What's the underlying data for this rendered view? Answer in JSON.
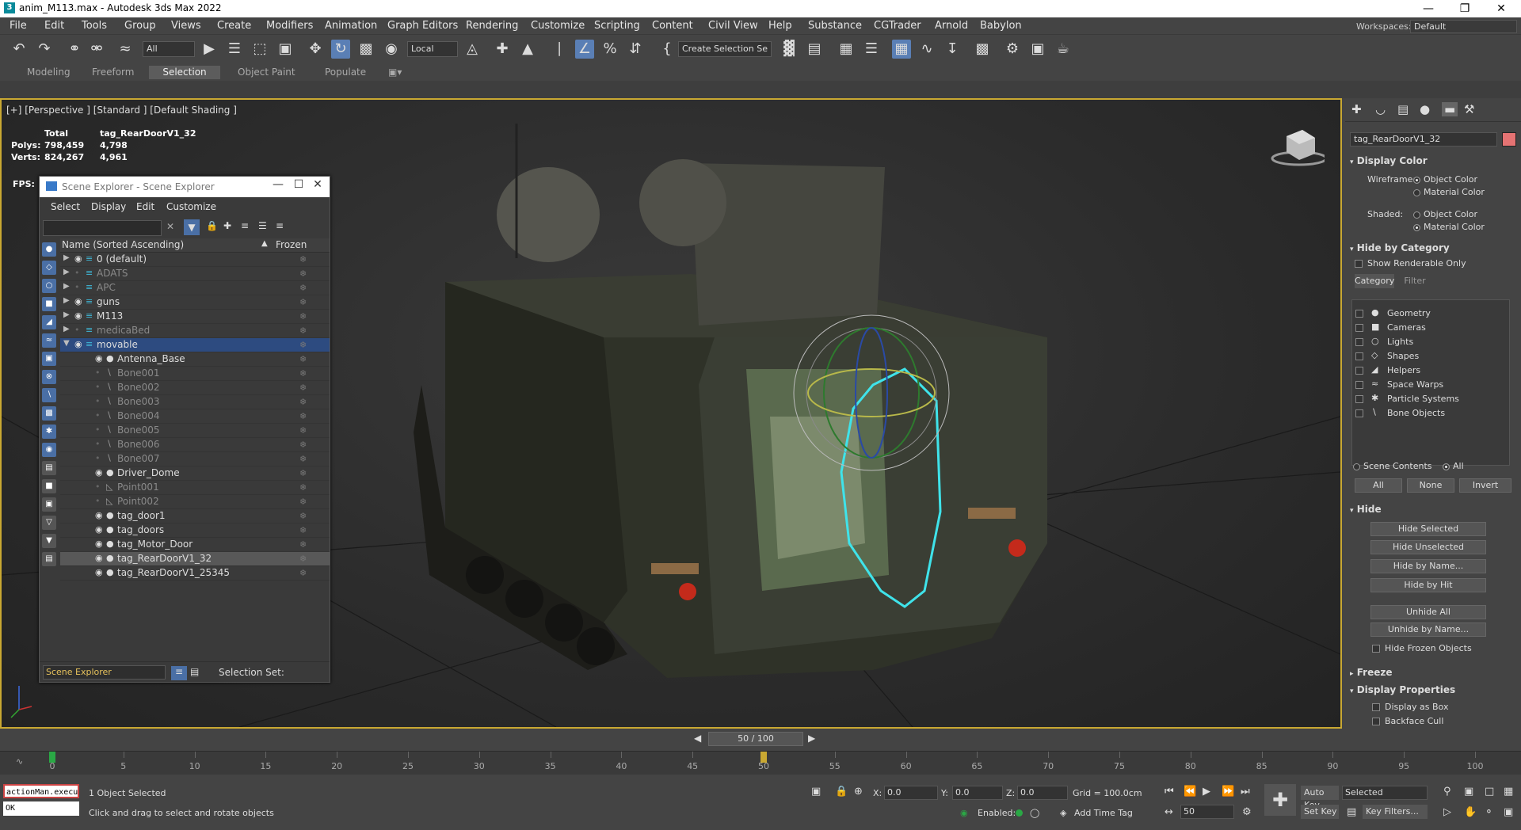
{
  "window": {
    "title": "anim_M113.max - Autodesk 3ds Max 2022",
    "app_icon": "3"
  },
  "menu": [
    "File",
    "Edit",
    "Tools",
    "Group",
    "Views",
    "Create",
    "Modifiers",
    "Animation",
    "Graph Editors",
    "Rendering",
    "Customize",
    "Scripting",
    "Content",
    "Civil View",
    "Help",
    "Substance",
    "CGTrader",
    "Arnold",
    "Babylon"
  ],
  "workspace": {
    "label": "Workspaces:",
    "value": "Default"
  },
  "toolbar": {
    "filter": "All",
    "coord": "Local",
    "selection_set": "Create Selection Se"
  },
  "ribbon_tabs": [
    "Modeling",
    "Freeform",
    "Selection",
    "Object Paint",
    "Populate"
  ],
  "viewport": {
    "label": "[+] [Perspective ] [Standard ] [Default Shading ]",
    "stats": {
      "total": "Total",
      "obj": "tag_RearDoorV1_32",
      "polys_label": "Polys:",
      "polys_total": "798,459",
      "polys_obj": "4,798",
      "verts_label": "Verts:",
      "verts_total": "824,267",
      "verts_obj": "4,961",
      "fps_label": "FPS:"
    }
  },
  "scene_explorer": {
    "title": "Scene Explorer - Scene Explorer",
    "menu": [
      "Select",
      "Display",
      "Edit",
      "Customize"
    ],
    "col_name": "Name (Sorted Ascending)",
    "col_frozen": "Frozen",
    "rows": [
      {
        "name": "0 (default)",
        "level": 0,
        "dim": false
      },
      {
        "name": "ADATS",
        "level": 0,
        "dim": true
      },
      {
        "name": "APC",
        "level": 0,
        "dim": true
      },
      {
        "name": "guns",
        "level": 0,
        "dim": false
      },
      {
        "name": "M113",
        "level": 0,
        "dim": false
      },
      {
        "name": "medicaBed",
        "level": 0,
        "dim": true
      },
      {
        "name": "movable",
        "level": 0,
        "dim": false
      },
      {
        "name": "Antenna_Base",
        "level": 1,
        "dim": false
      },
      {
        "name": "Bone001",
        "level": 1,
        "dim": true
      },
      {
        "name": "Bone002",
        "level": 1,
        "dim": true
      },
      {
        "name": "Bone003",
        "level": 1,
        "dim": true
      },
      {
        "name": "Bone004",
        "level": 1,
        "dim": true
      },
      {
        "name": "Bone005",
        "level": 1,
        "dim": true
      },
      {
        "name": "Bone006",
        "level": 1,
        "dim": true
      },
      {
        "name": "Bone007",
        "level": 1,
        "dim": true
      },
      {
        "name": "Driver_Dome",
        "level": 1,
        "dim": false
      },
      {
        "name": "Point001",
        "level": 1,
        "dim": true
      },
      {
        "name": "Point002",
        "level": 1,
        "dim": true
      },
      {
        "name": "tag_door1",
        "level": 1,
        "dim": false
      },
      {
        "name": "tag_doors",
        "level": 1,
        "dim": false
      },
      {
        "name": "tag_Motor_Door",
        "level": 1,
        "dim": false
      },
      {
        "name": "tag_RearDoorV1_32",
        "level": 1,
        "dim": false
      },
      {
        "name": "tag_RearDoorV1_25345",
        "level": 1,
        "dim": false
      }
    ],
    "footer_dropdown": "Scene Explorer",
    "selection_set_label": "Selection Set:"
  },
  "command_panel": {
    "object_name": "tag_RearDoorV1_32",
    "display_color": {
      "heading": "Display Color",
      "wireframe": "Wireframe:",
      "shaded": "Shaded:",
      "object_color": "Object Color",
      "material_color": "Material Color"
    },
    "hide_by_category": {
      "heading": "Hide by Category",
      "show_renderable": "Show Renderable Only",
      "tab_category": "Category",
      "tab_filter": "Filter",
      "items": [
        "Geometry",
        "Cameras",
        "Lights",
        "Shapes",
        "Helpers",
        "Space Warps",
        "Particle Systems",
        "Bone Objects"
      ],
      "scene_contents": "Scene Contents",
      "all_radio": "All",
      "btn_all": "All",
      "btn_none": "None",
      "btn_invert": "Invert"
    },
    "hide": {
      "heading": "Hide",
      "hide_selected": "Hide Selected",
      "hide_unselected": "Hide Unselected",
      "hide_by_name": "Hide by Name...",
      "hide_by_hit": "Hide by Hit",
      "unhide_all": "Unhide All",
      "unhide_by_name": "Unhide by Name...",
      "hide_frozen": "Hide Frozen Objects"
    },
    "freeze": {
      "heading": "Freeze"
    },
    "display_properties": {
      "heading": "Display Properties",
      "as_box": "Display as Box",
      "backface": "Backface Cull"
    }
  },
  "timeline": {
    "frame": "50 / 100",
    "current": 50,
    "max": 100,
    "ticks": [
      "0",
      "5",
      "10",
      "15",
      "20",
      "25",
      "30",
      "35",
      "40",
      "45",
      "50",
      "55",
      "60",
      "65",
      "70",
      "75",
      "80",
      "85",
      "90",
      "95",
      "100"
    ]
  },
  "status": {
    "maxscript_input": "actionMan.execu",
    "maxscript_output": "OK",
    "selected": "1 Object Selected",
    "prompt": "Click and drag to select and rotate objects",
    "x_label": "X:",
    "x": "0.0",
    "y_label": "Y:",
    "y": "0.0",
    "z_label": "Z:",
    "z": "0.0",
    "grid": "Grid = 100.0cm",
    "enabled": "Enabled:",
    "add_time_tag": "Add Time Tag",
    "auto_key": "Auto Key",
    "set_key": "Set Key",
    "key_mode": "Selected",
    "key_filters": "Key Filters...",
    "frame_field": "50"
  }
}
